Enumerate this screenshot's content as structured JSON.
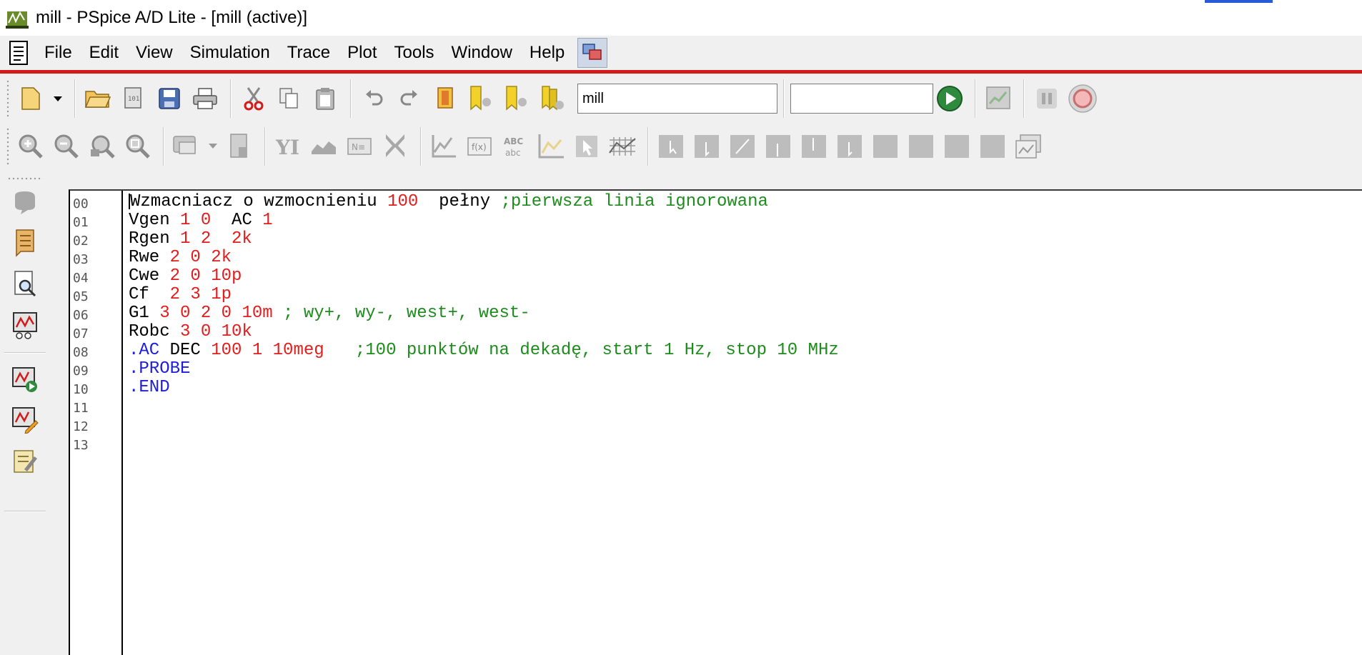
{
  "window": {
    "title": "mill - PSpice A/D Lite - [mill (active)]"
  },
  "menu": [
    "File",
    "Edit",
    "View",
    "Simulation",
    "Trace",
    "Plot",
    "Tools",
    "Window",
    "Help"
  ],
  "toolbar": {
    "profile_value": "mill",
    "second_combo_value": ""
  },
  "editor": {
    "line_numbers": [
      "00",
      "01",
      "02",
      "03",
      "04",
      "05",
      "06",
      "07",
      "08",
      "09",
      "10",
      "11",
      "12",
      "13"
    ],
    "lines": [
      [
        {
          "t": "k",
          "v": "Wzmacniacz o wzmocnieniu "
        },
        {
          "t": "n",
          "v": "100"
        },
        {
          "t": "k",
          "v": "  pełny "
        },
        {
          "t": "c",
          "v": ";pierwsza linia ignorowana"
        }
      ],
      [
        {
          "t": "k",
          "v": "Vgen "
        },
        {
          "t": "n",
          "v": "1 0"
        },
        {
          "t": "k",
          "v": "  AC "
        },
        {
          "t": "n",
          "v": "1"
        }
      ],
      [
        {
          "t": "k",
          "v": "Rgen "
        },
        {
          "t": "n",
          "v": "1 2  2k"
        }
      ],
      [
        {
          "t": "k",
          "v": "Rwe "
        },
        {
          "t": "n",
          "v": "2 0 2k"
        }
      ],
      [
        {
          "t": "k",
          "v": "Cwe "
        },
        {
          "t": "n",
          "v": "2 0 10p"
        }
      ],
      [
        {
          "t": "k",
          "v": "Cf  "
        },
        {
          "t": "n",
          "v": "2 3 1p"
        }
      ],
      [
        {
          "t": "k",
          "v": "G1 "
        },
        {
          "t": "n",
          "v": "3 0 2 0 10m"
        },
        {
          "t": "c",
          "v": " ; wy+, wy-, west+, west-"
        }
      ],
      [
        {
          "t": "k",
          "v": "Robc "
        },
        {
          "t": "n",
          "v": "3 0 10k"
        }
      ],
      [
        {
          "t": "d",
          "v": ".AC"
        },
        {
          "t": "k",
          "v": " DEC "
        },
        {
          "t": "n",
          "v": "100 1 10meg"
        },
        {
          "t": "c",
          "v": "   ;100 punktów na dekadę, start 1 Hz, stop 10 MHz"
        }
      ],
      [
        {
          "t": "d",
          "v": ".PROBE"
        }
      ],
      [
        {
          "t": "d",
          "v": ".END"
        }
      ],
      [],
      [],
      []
    ]
  },
  "colors": {
    "menu_red_line": "#d21a1a",
    "keyword": "#000000",
    "number": "#e11d1d",
    "comment": "#1d8c1d",
    "directive": "#1e1ed8"
  },
  "icons": {
    "toolbar_row1": [
      "new-file-icon",
      "dropdown-arrow-icon",
      "open-folder-icon",
      "new-project-icon",
      "save-icon",
      "print-icon",
      "cut-icon",
      "copy-icon",
      "paste-icon",
      "undo-icon",
      "redo-icon",
      "bookmark-icon",
      "bookmark-prev-icon",
      "bookmark-next-icon",
      "bookmark-clear-icon",
      "run-icon",
      "view-waveform-icon",
      "pause-icon",
      "stop-icon"
    ],
    "toolbar_row2": [
      "zoom-in-icon",
      "zoom-out-icon",
      "zoom-area-icon",
      "zoom-fit-icon",
      "log-x-icon",
      "fourier-icon",
      "performance-icon",
      "add-trace-icon",
      "eval-goal-icon",
      "plot-label-icon",
      "cursor-icon"
    ],
    "left_bar": [
      "simulation-status-icon",
      "output-file-icon",
      "find-icon",
      "waveform-icon",
      "run-simulation-icon",
      "edit-profile-icon",
      "edit-stimulus-icon"
    ]
  }
}
